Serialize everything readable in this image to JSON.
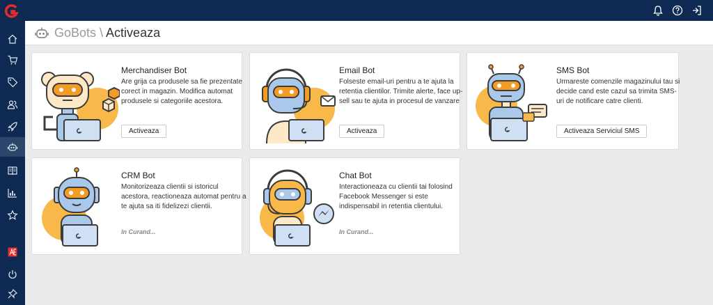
{
  "header": {
    "root": "GoBots",
    "separator": " \\ ",
    "current": "Activeaza"
  },
  "topbar": {
    "icons": [
      "bell-icon",
      "help-icon",
      "logout-icon"
    ]
  },
  "sidebar": {
    "items": [
      {
        "icon": "home-icon",
        "active": false
      },
      {
        "icon": "cart-icon",
        "active": false
      },
      {
        "icon": "tag-icon",
        "active": false
      },
      {
        "icon": "users-icon",
        "active": false
      },
      {
        "icon": "rocket-icon",
        "active": false
      },
      {
        "icon": "robot-icon",
        "active": true
      },
      {
        "icon": "book-icon",
        "active": false
      },
      {
        "icon": "chart-icon",
        "active": false
      },
      {
        "icon": "star-icon",
        "active": false
      },
      {
        "icon": "brand-icon",
        "active": false
      },
      {
        "icon": "power-icon",
        "active": false
      },
      {
        "icon": "pin-icon",
        "active": false
      }
    ]
  },
  "cards": {
    "merch": {
      "name": "Merchandiser Bot",
      "desc": "Are grija ca produsele sa fie prezentate corect in magazin. Modifica automat produsele si categoriile acestora.",
      "button": "Activeaza"
    },
    "email": {
      "name": "Email Bot",
      "desc": "Folseste email-uri pentru a te ajuta la retentia clientilor. Trimite alerte, face up-sell sau te ajuta in procesul de vanzare",
      "button": "Activeaza"
    },
    "sms": {
      "name": "SMS Bot",
      "desc": "Urmareste comenzile magazinului tau si decide cand este cazul sa trimita SMS-uri de notificare catre clienti.",
      "button": "Activeaza Serviciul SMS"
    },
    "crm": {
      "name": "CRM Bot",
      "desc": "Monitorizeaza clientii si istoricul acestora, reactioneaza automat pentru a te ajuta sa iti fidelizezi clientii.",
      "status": "In Curand..."
    },
    "chat": {
      "name": "Chat Bot",
      "desc": "Interactioneaza cu clientii tai folosind Facebook Messenger si este indispensabil in retentia clientului.",
      "status": "In Curand..."
    }
  },
  "colors": {
    "navy": "#0e2a52",
    "accent": "#f9b94a",
    "robot": "#a9c8ea",
    "brand": "#e52b2b"
  }
}
